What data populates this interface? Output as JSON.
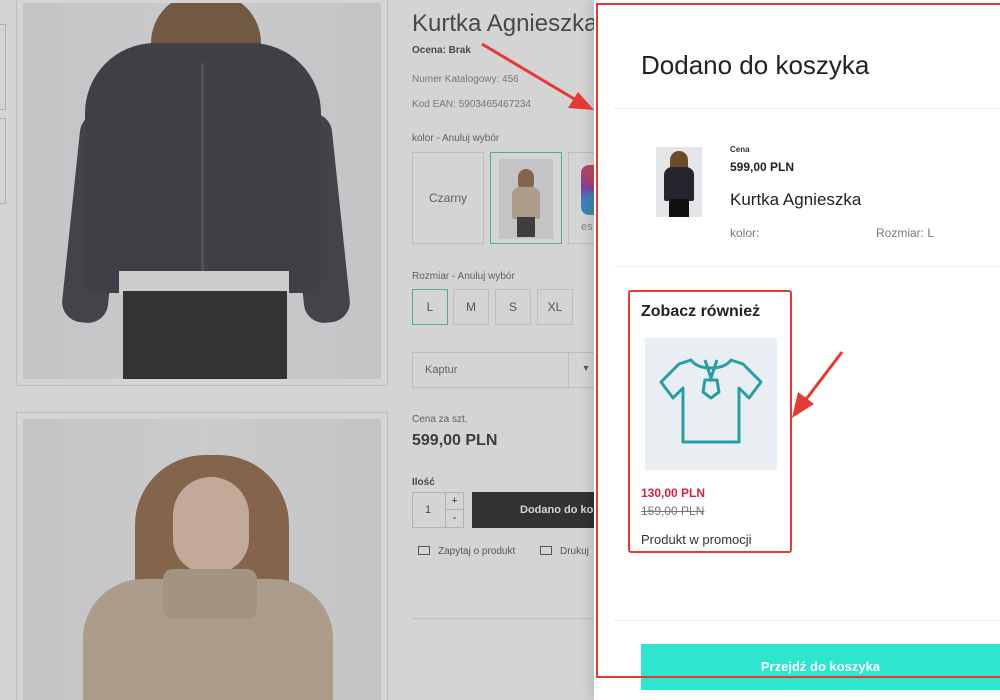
{
  "product": {
    "title": "Kurtka Agnieszka",
    "rating": "Ocena: Brak",
    "catalog_number": "Numer Katalogowy: 456",
    "ean": "Kod EAN: 5903465467234",
    "color_label": "kolor - Anuluj wybór",
    "color_option_1": "Czarny",
    "color_option_3_text": "es",
    "size_label": "Rozmiar - Anuluj wybór",
    "sizes": [
      "L",
      "M",
      "S",
      "XL"
    ],
    "extra_select_value": "Kaptur",
    "price_label": "Cena za szt.",
    "price": "599,00 PLN",
    "qty_label": "Ilość",
    "qty_value": "1",
    "qty_plus": "+",
    "qty_minus": "-",
    "add_button_label": "Dodano do koszyka",
    "ask_link": "Zapytaj o produkt",
    "print_link": "Drukuj"
  },
  "cart_panel": {
    "title": "Dodano do koszyka",
    "item": {
      "price_label": "Cena",
      "price": "599,00 PLN",
      "name": "Kurtka Agnieszka",
      "color_label": "kolor:",
      "size_label": "Rozmiar: L"
    },
    "see_also": {
      "title": "Zobacz również",
      "price": "130,00 PLN",
      "old_price": "159,00 PLN",
      "name": "Produkt w promocji"
    },
    "go_to_cart_label": "Przejdź do koszyka"
  },
  "colors": {
    "accent_teal": "#2ee5cf",
    "promo_price_red": "#d0243a",
    "annotation_red": "#e53935",
    "add_button_black": "#111111"
  }
}
